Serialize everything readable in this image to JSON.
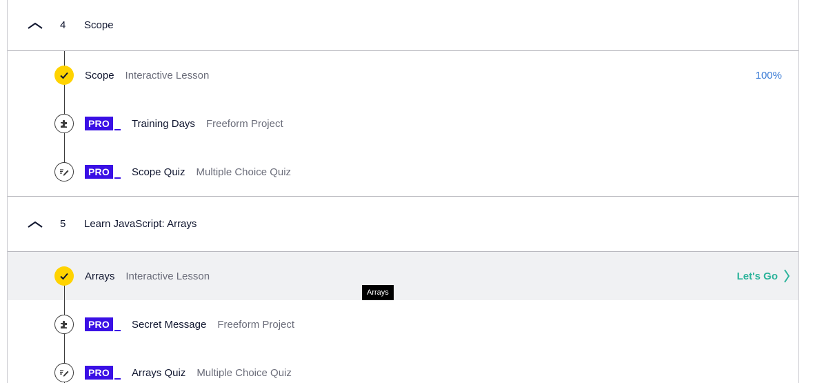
{
  "modules": [
    {
      "number": "4",
      "title": "Scope",
      "items": [
        {
          "name": "Scope",
          "type": "Interactive Lesson",
          "status": "completed",
          "progress": "100%"
        },
        {
          "badge": "PRO",
          "name": "Training Days",
          "type": "Freeform Project",
          "icon": "puzzle-icon"
        },
        {
          "badge": "PRO",
          "name": "Scope Quiz",
          "type": "Multiple Choice Quiz",
          "icon": "quiz-pencil-icon"
        }
      ]
    },
    {
      "number": "5",
      "title": "Learn JavaScript: Arrays",
      "items": [
        {
          "name": "Arrays",
          "type": "Interactive Lesson",
          "status": "completed",
          "action": "Let's Go"
        },
        {
          "badge": "PRO",
          "name": "Secret Message",
          "type": "Freeform Project",
          "icon": "puzzle-icon"
        },
        {
          "badge": "PRO",
          "name": "Arrays Quiz",
          "type": "Multiple Choice Quiz",
          "icon": "quiz-pencil-icon"
        }
      ]
    }
  ],
  "tooltip": "Arrays",
  "colors": {
    "check": "#ffd300",
    "pro": "#3a10e5",
    "progress": "#3a7bd5",
    "action": "#2bb39a",
    "hover": "#f0f1f3"
  }
}
